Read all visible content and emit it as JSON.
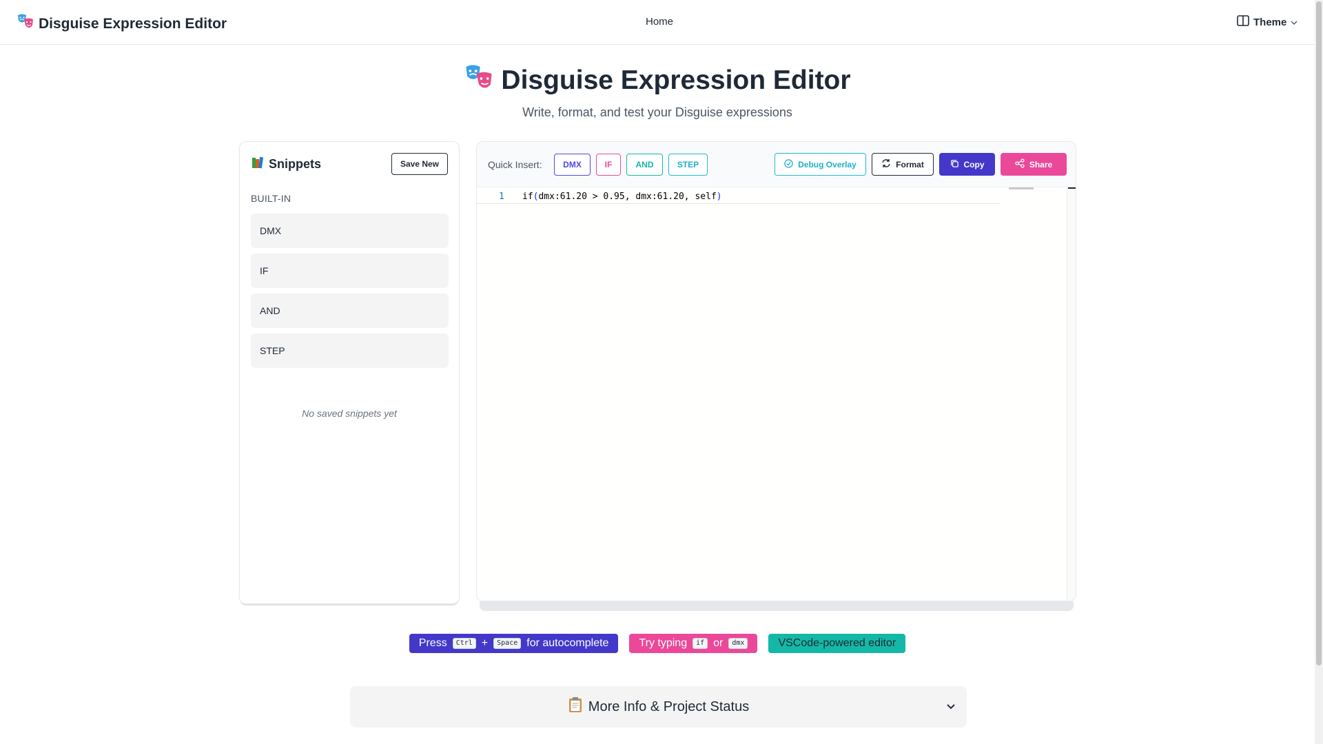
{
  "navbar": {
    "brand": "Disguise Expression Editor",
    "home": "Home",
    "theme": "Theme"
  },
  "hero": {
    "title": "Disguise Expression Editor",
    "subtitle": "Write, format, and test your Disguise expressions"
  },
  "snippets": {
    "title": "Snippets",
    "save_new": "Save New",
    "builtin_label": "BUILT-IN",
    "builtin_items": [
      "DMX",
      "IF",
      "AND",
      "STEP"
    ],
    "empty_text": "No saved snippets yet"
  },
  "editor": {
    "quick_insert_label": "Quick Insert:",
    "chips": [
      "DMX",
      "IF",
      "AND",
      "STEP"
    ],
    "buttons": {
      "debug": "Debug Overlay",
      "format": "Format",
      "copy": "Copy",
      "share": "Share"
    },
    "line_number": "1",
    "code": {
      "fn": "if",
      "open": "(",
      "body": "dmx:61.20 > 0.95, dmx:61.20, self",
      "close": ")"
    }
  },
  "hints": {
    "autocomplete": {
      "prefix": "Press",
      "key1": "Ctrl",
      "plus": "+",
      "key2": "Space",
      "suffix": "for autocomplete"
    },
    "typing": {
      "prefix": "Try typing",
      "key1": "if",
      "or": "or",
      "key2": "dmx"
    },
    "vscode": "VSCode-powered editor"
  },
  "info": {
    "title": "More Info & Project Status"
  },
  "colors": {
    "indigo": "#4338ca",
    "pink": "#ec4899",
    "teal": "#14b8a6",
    "cyan": "#22b8cf"
  }
}
